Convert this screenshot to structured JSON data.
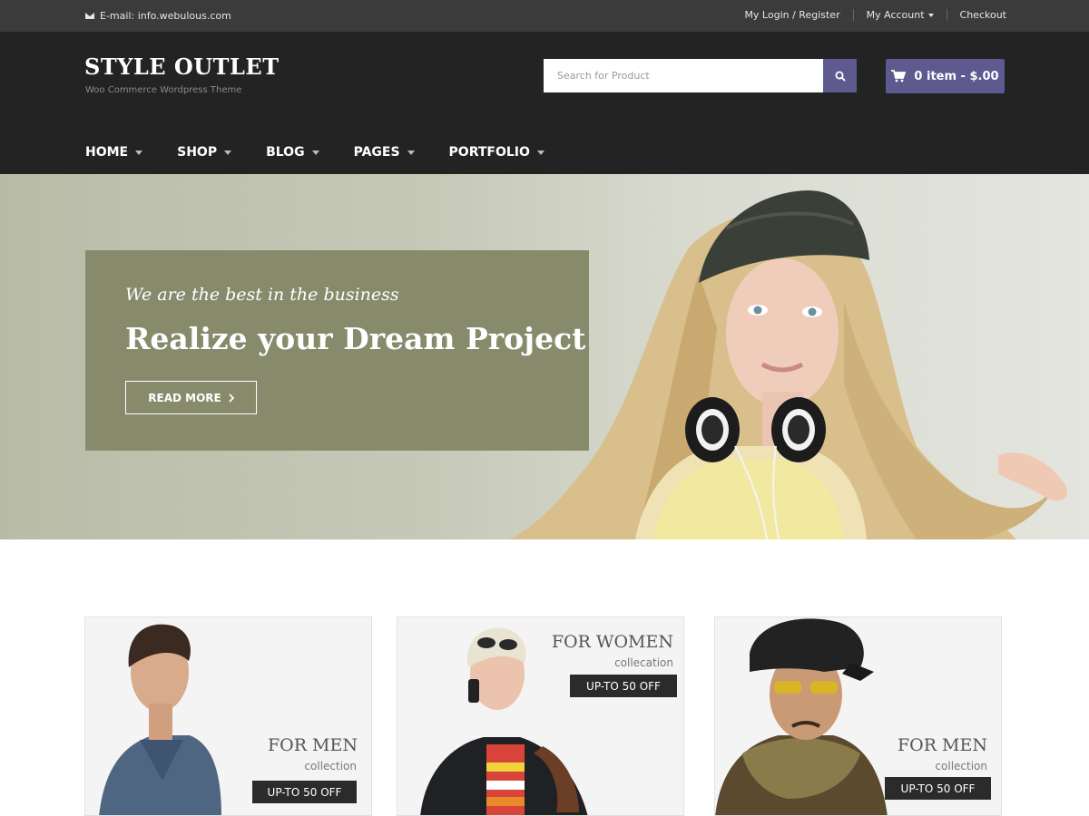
{
  "topbar": {
    "email": "E-mail: info.webulous.com",
    "links": [
      "My Login / Register",
      "My Account",
      "Checkout"
    ]
  },
  "header": {
    "logo_title": "STYLE OUTLET",
    "logo_subtitle": "Woo Commerce Wordpress Theme",
    "search_placeholder": "Search for Product",
    "cart_label": "0 item - $.00",
    "nav": [
      "HOME",
      "SHOP",
      "BLOG",
      "PAGES",
      "PORTFOLIO"
    ]
  },
  "hero": {
    "script_text": "We are the best in the business",
    "title": "Realize your Dream Project",
    "button_label": "READ MORE"
  },
  "cards": [
    {
      "title": "FOR MEN",
      "subtitle": "collection",
      "badge": "UP-TO 50 OFF"
    },
    {
      "title": "FOR WOMEN",
      "subtitle": "collecation",
      "badge": "UP-TO 50 OFF"
    },
    {
      "title": "FOR MEN",
      "subtitle": "collection",
      "badge": "UP-TO 50 OFF"
    }
  ],
  "colors": {
    "accent": "#5e5a8f",
    "header_bg": "#232323",
    "topbar_bg": "#3b3b3b",
    "hero_panel": "#878b6c"
  },
  "icons": [
    "envelope-icon",
    "caret-down-icon",
    "search-icon",
    "cart-icon",
    "chevron-right-icon"
  ]
}
